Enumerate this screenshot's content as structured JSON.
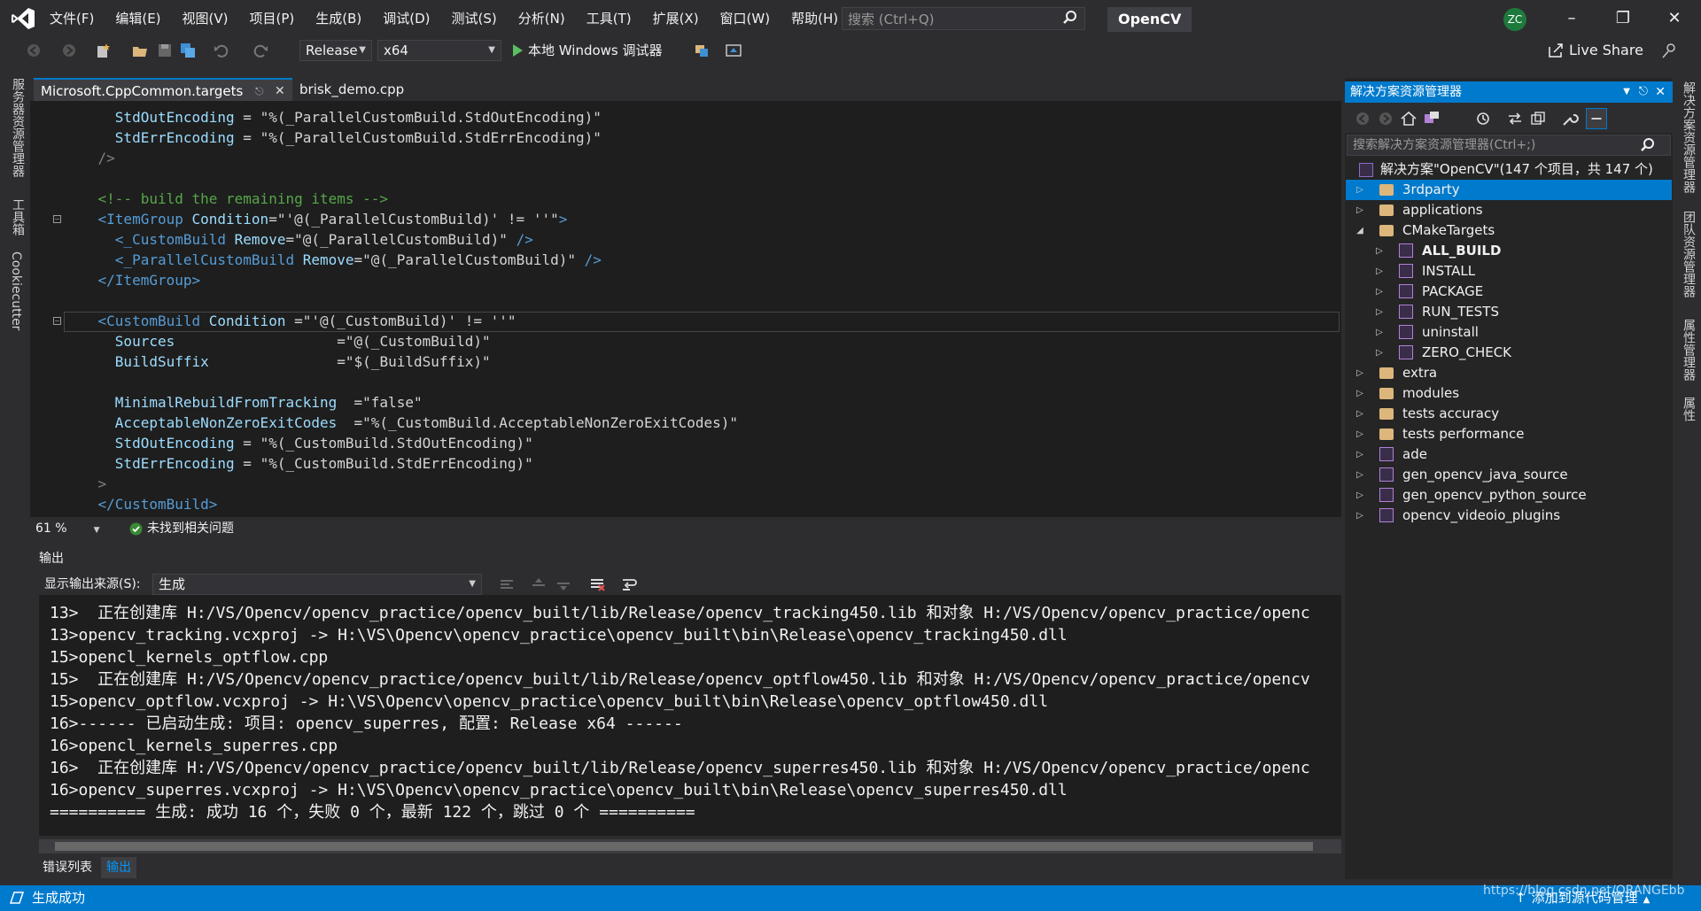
{
  "window": {
    "menu": [
      "文件(F)",
      "编辑(E)",
      "视图(V)",
      "项目(P)",
      "生成(B)",
      "调试(D)",
      "测试(S)",
      "分析(N)",
      "工具(T)",
      "扩展(X)",
      "窗口(W)",
      "帮助(H)"
    ],
    "search_placeholder": "搜索 (Ctrl+Q)",
    "solution_name": "OpenCV",
    "avatar": "ZC"
  },
  "toolbar": {
    "configuration": "Release",
    "platform": "x64",
    "debugger": "本地 Windows 调试器",
    "live_share": "Live Share"
  },
  "left_rail": [
    "服务器资源管理器",
    "工具箱",
    "Cookiecutter"
  ],
  "editor": {
    "tabs": [
      "Microsoft.CppCommon.targets",
      "brisk_demo.cpp"
    ],
    "zoom": "61 %",
    "issues": "未找到相关问题"
  },
  "code": [
    {
      "indent": "      ",
      "name": "StdOutEncoding",
      "pad": " ",
      "eq": "= ",
      "value": "\"%(_ParallelCustomBuild.StdOutEncoding)\""
    },
    {
      "indent": "      ",
      "name": "StdErrEncoding",
      "pad": " ",
      "eq": "= ",
      "value": "\"%(_ParallelCustomBuild.StdErrEncoding)\""
    },
    {
      "indent": "    ",
      "text": "/>"
    },
    {
      "indent": "",
      "text": ""
    },
    {
      "indent": "    ",
      "comment": "<!-- build the remaining items -->"
    },
    {
      "indent": "    ",
      "open": "<ItemGroup",
      "attr": " Condition",
      "eq": "=",
      "value": "\"'@(_ParallelCustomBuild)' != ''\"",
      "close": ">"
    },
    {
      "indent": "      ",
      "open": "<_CustomBuild",
      "attr": " Remove",
      "eq": "=",
      "value": "\"@(_ParallelCustomBuild)\"",
      "close": " />"
    },
    {
      "indent": "      ",
      "open": "<_ParallelCustomBuild",
      "attr": " Remove",
      "eq": "=",
      "value": "\"@(_ParallelCustomBuild)\"",
      "close": " />"
    },
    {
      "indent": "    ",
      "open": "</ItemGroup",
      "close": ">"
    },
    {
      "indent": "",
      "text": ""
    },
    {
      "indent": "    ",
      "open": "<CustomBuild",
      "attr": " Condition",
      "eq": " =",
      "value": "\"'@(_CustomBuild)' != ''\"",
      "close": ""
    },
    {
      "indent": "      ",
      "name": "Sources",
      "pad": "                   ",
      "eq": "=",
      "value": "\"@(_CustomBuild)\""
    },
    {
      "indent": "      ",
      "name": "BuildSuffix",
      "pad": "               ",
      "eq": "=",
      "value": "\"$(_BuildSuffix)\""
    },
    {
      "indent": "",
      "text": ""
    },
    {
      "indent": "      ",
      "name": "MinimalRebuildFromTracking",
      "pad": "  ",
      "eq": "=",
      "value": "\"false\""
    },
    {
      "indent": "      ",
      "name": "AcceptableNonZeroExitCodes",
      "pad": "  ",
      "eq": "=",
      "value": "\"%(_CustomBuild.AcceptableNonZeroExitCodes)\""
    },
    {
      "indent": "      ",
      "name": "StdOutEncoding",
      "pad": " ",
      "eq": "= ",
      "value": "\"%(_CustomBuild.StdOutEncoding)\""
    },
    {
      "indent": "      ",
      "name": "StdErrEncoding",
      "pad": " ",
      "eq": "= ",
      "value": "\"%(_CustomBuild.StdErrEncoding)\""
    },
    {
      "indent": "    ",
      "text": ">"
    },
    {
      "indent": "    ",
      "open": "</CustomBuild",
      "close": ">"
    }
  ],
  "output": {
    "title": "输出",
    "source_label": "显示输出来源(S):",
    "source_value": "生成",
    "lines": [
      "13>  正在创建库 H:/VS/Opencv/opencv_practice/opencv_built/lib/Release/opencv_tracking450.lib 和对象 H:/VS/Opencv/opencv_practice/openc",
      "13>opencv_tracking.vcxproj -> H:\\VS\\Opencv\\opencv_practice\\opencv_built\\bin\\Release\\opencv_tracking450.dll",
      "15>opencl_kernels_optflow.cpp",
      "15>  正在创建库 H:/VS/Opencv/opencv_practice/opencv_built/lib/Release/opencv_optflow450.lib 和对象 H:/VS/Opencv/opencv_practice/opencv",
      "15>opencv_optflow.vcxproj -> H:\\VS\\Opencv\\opencv_practice\\opencv_built\\bin\\Release\\opencv_optflow450.dll",
      "16>------ 已启动生成: 项目: opencv_superres, 配置: Release x64 ------",
      "16>opencl_kernels_superres.cpp",
      "16>  正在创建库 H:/VS/Opencv/opencv_practice/opencv_built/lib/Release/opencv_superres450.lib 和对象 H:/VS/Opencv/opencv_practice/openc",
      "16>opencv_superres.vcxproj -> H:\\VS\\Opencv\\opencv_practice\\opencv_built\\bin\\Release\\opencv_superres450.dll",
      "========== 生成: 成功 16 个，失败 0 个，最新 122 个，跳过 0 个 =========="
    ],
    "bottom_tabs": [
      "错误列表",
      "输出"
    ]
  },
  "solution_explorer": {
    "title": "解决方案资源管理器",
    "search_placeholder": "搜索解决方案资源管理器(Ctrl+;)",
    "root": "解决方案\"OpenCV\"(147 个项目，共 147 个)",
    "items": [
      {
        "label": "3rdparty",
        "kind": "folder",
        "level": 0,
        "expand": "closed",
        "selected": true
      },
      {
        "label": "applications",
        "kind": "folder",
        "level": 0,
        "expand": "closed"
      },
      {
        "label": "CMakeTargets",
        "kind": "folder",
        "level": 0,
        "expand": "open"
      },
      {
        "label": "ALL_BUILD",
        "kind": "project",
        "level": 1,
        "expand": "closed",
        "bold": true
      },
      {
        "label": "INSTALL",
        "kind": "project",
        "level": 1,
        "expand": "closed"
      },
      {
        "label": "PACKAGE",
        "kind": "project",
        "level": 1,
        "expand": "closed"
      },
      {
        "label": "RUN_TESTS",
        "kind": "project",
        "level": 1,
        "expand": "closed"
      },
      {
        "label": "uninstall",
        "kind": "project",
        "level": 1,
        "expand": "closed"
      },
      {
        "label": "ZERO_CHECK",
        "kind": "project",
        "level": 1,
        "expand": "closed"
      },
      {
        "label": "extra",
        "kind": "folder",
        "level": 0,
        "expand": "closed"
      },
      {
        "label": "modules",
        "kind": "folder",
        "level": 0,
        "expand": "closed"
      },
      {
        "label": "tests accuracy",
        "kind": "folder",
        "level": 0,
        "expand": "closed"
      },
      {
        "label": "tests performance",
        "kind": "folder",
        "level": 0,
        "expand": "closed"
      },
      {
        "label": "ade",
        "kind": "project",
        "level": 0,
        "expand": "closed"
      },
      {
        "label": "gen_opencv_java_source",
        "kind": "project",
        "level": 0,
        "expand": "closed"
      },
      {
        "label": "gen_opencv_python_source",
        "kind": "project",
        "level": 0,
        "expand": "closed"
      },
      {
        "label": "opencv_videoio_plugins",
        "kind": "project",
        "level": 0,
        "expand": "closed"
      }
    ]
  },
  "right_rail": [
    "解决方案资源管理器",
    "团队资源管理器",
    "属性管理器",
    "属性"
  ],
  "status": {
    "text": "生成成功",
    "source_control": "添加到源代码管理",
    "watermark": "https://blog.csdn.net/ORANGEbb"
  },
  "colors": {
    "accent": "#007acc",
    "background": "#2d2d30",
    "editor": "#1e1e1e"
  }
}
